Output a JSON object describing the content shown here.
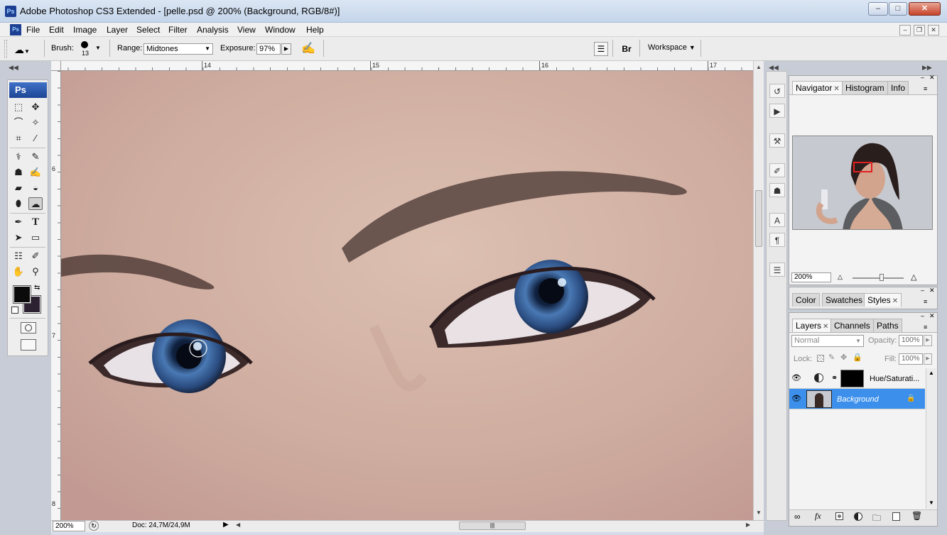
{
  "window": {
    "title": "Adobe Photoshop CS3 Extended - [pelle.psd @ 200% (Background, RGB/8#)]",
    "app_icon": "Ps"
  },
  "menu": [
    "File",
    "Edit",
    "Image",
    "Layer",
    "Select",
    "Filter",
    "Analysis",
    "View",
    "Window",
    "Help"
  ],
  "options": {
    "brush_label": "Brush:",
    "brush_size": "13",
    "range_label": "Range:",
    "range_value": "Midtones",
    "exposure_label": "Exposure:",
    "exposure_value": "97%",
    "workspace_label": "Workspace"
  },
  "toolbox": {
    "logo": "Ps",
    "foreground_color": "#0b0b0b",
    "background_color": "#2b2130"
  },
  "rulers": {
    "top": [
      "14",
      "15",
      "16",
      "17"
    ],
    "left": [
      "6",
      "7",
      "8"
    ]
  },
  "status": {
    "zoom": "200%",
    "doc": "Doc: 24,7M/24,9M"
  },
  "navigator": {
    "tabs": [
      "Navigator",
      "Histogram",
      "Info"
    ],
    "zoom": "200%"
  },
  "color_panel": {
    "tabs": [
      "Color",
      "Swatches",
      "Styles"
    ]
  },
  "layers_panel": {
    "tabs": [
      "Layers",
      "Channels",
      "Paths"
    ],
    "blend_mode": "Normal",
    "opacity_label": "Opacity:",
    "opacity_value": "100%",
    "lock_label": "Lock:",
    "fill_label": "Fill:",
    "fill_value": "100%",
    "layers": [
      {
        "name": "Hue/Saturati..."
      },
      {
        "name": "Background"
      }
    ]
  },
  "colors": {
    "accent": "#3c90ec",
    "chrome": "#d6dbe9"
  }
}
